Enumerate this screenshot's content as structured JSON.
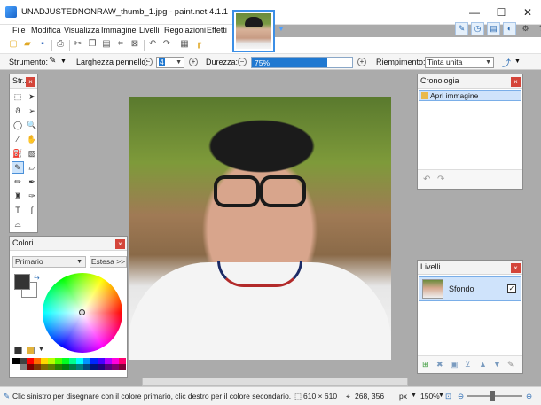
{
  "window": {
    "title": "UNADJUSTEDNONRAW_thumb_1.jpg - paint.net 4.1.1",
    "minimize": "—",
    "maximize": "☐",
    "close": "✕"
  },
  "menu": [
    "File",
    "Modifica",
    "Visualizza",
    "Immagine",
    "Livelli",
    "Regolazioni",
    "Effetti"
  ],
  "toolbar2": {
    "tool_label": "Strumento:",
    "brush_width_label": "Larghezza pennello:",
    "brush_width_value": "4",
    "hardness_label": "Durezza:",
    "hardness_value": "75%",
    "hardness_fraction": 0.75,
    "fill_label": "Riempimento:",
    "fill_value": "Tinta unita"
  },
  "tools_panel": {
    "title": "Str..."
  },
  "colors_panel": {
    "title": "Colori",
    "mode": "Primario",
    "more_button": "Estesa >>",
    "primary_color": "#333333",
    "secondary_color": "#ffffff"
  },
  "history_panel": {
    "title": "Cronologia",
    "items": [
      "Apri immagine"
    ]
  },
  "layers_panel": {
    "title": "Livelli",
    "layers": [
      {
        "name": "Sfondo",
        "visible": true
      }
    ]
  },
  "status": {
    "hint": "Clic sinistro per disegnare con il colore primario, clic destro per il colore secondario.",
    "image_size": "610 × 610",
    "cursor_pos": "268, 356",
    "unit": "px",
    "zoom": "150%"
  },
  "palette": [
    "#000000",
    "#404040",
    "#ff0000",
    "#ff6a00",
    "#ffd800",
    "#b6ff00",
    "#4cff00",
    "#00ff21",
    "#00ff90",
    "#00ffff",
    "#0094ff",
    "#0026ff",
    "#4800ff",
    "#b200ff",
    "#ff00dc",
    "#ff006e",
    "#ffffff",
    "#808080",
    "#7f0000",
    "#7f3300",
    "#7f6a00",
    "#5b7f00",
    "#267f00",
    "#007f0e",
    "#007f46",
    "#007f7f",
    "#004a7f",
    "#00137f",
    "#21007f",
    "#57007f",
    "#7f006e",
    "#7f0037"
  ]
}
